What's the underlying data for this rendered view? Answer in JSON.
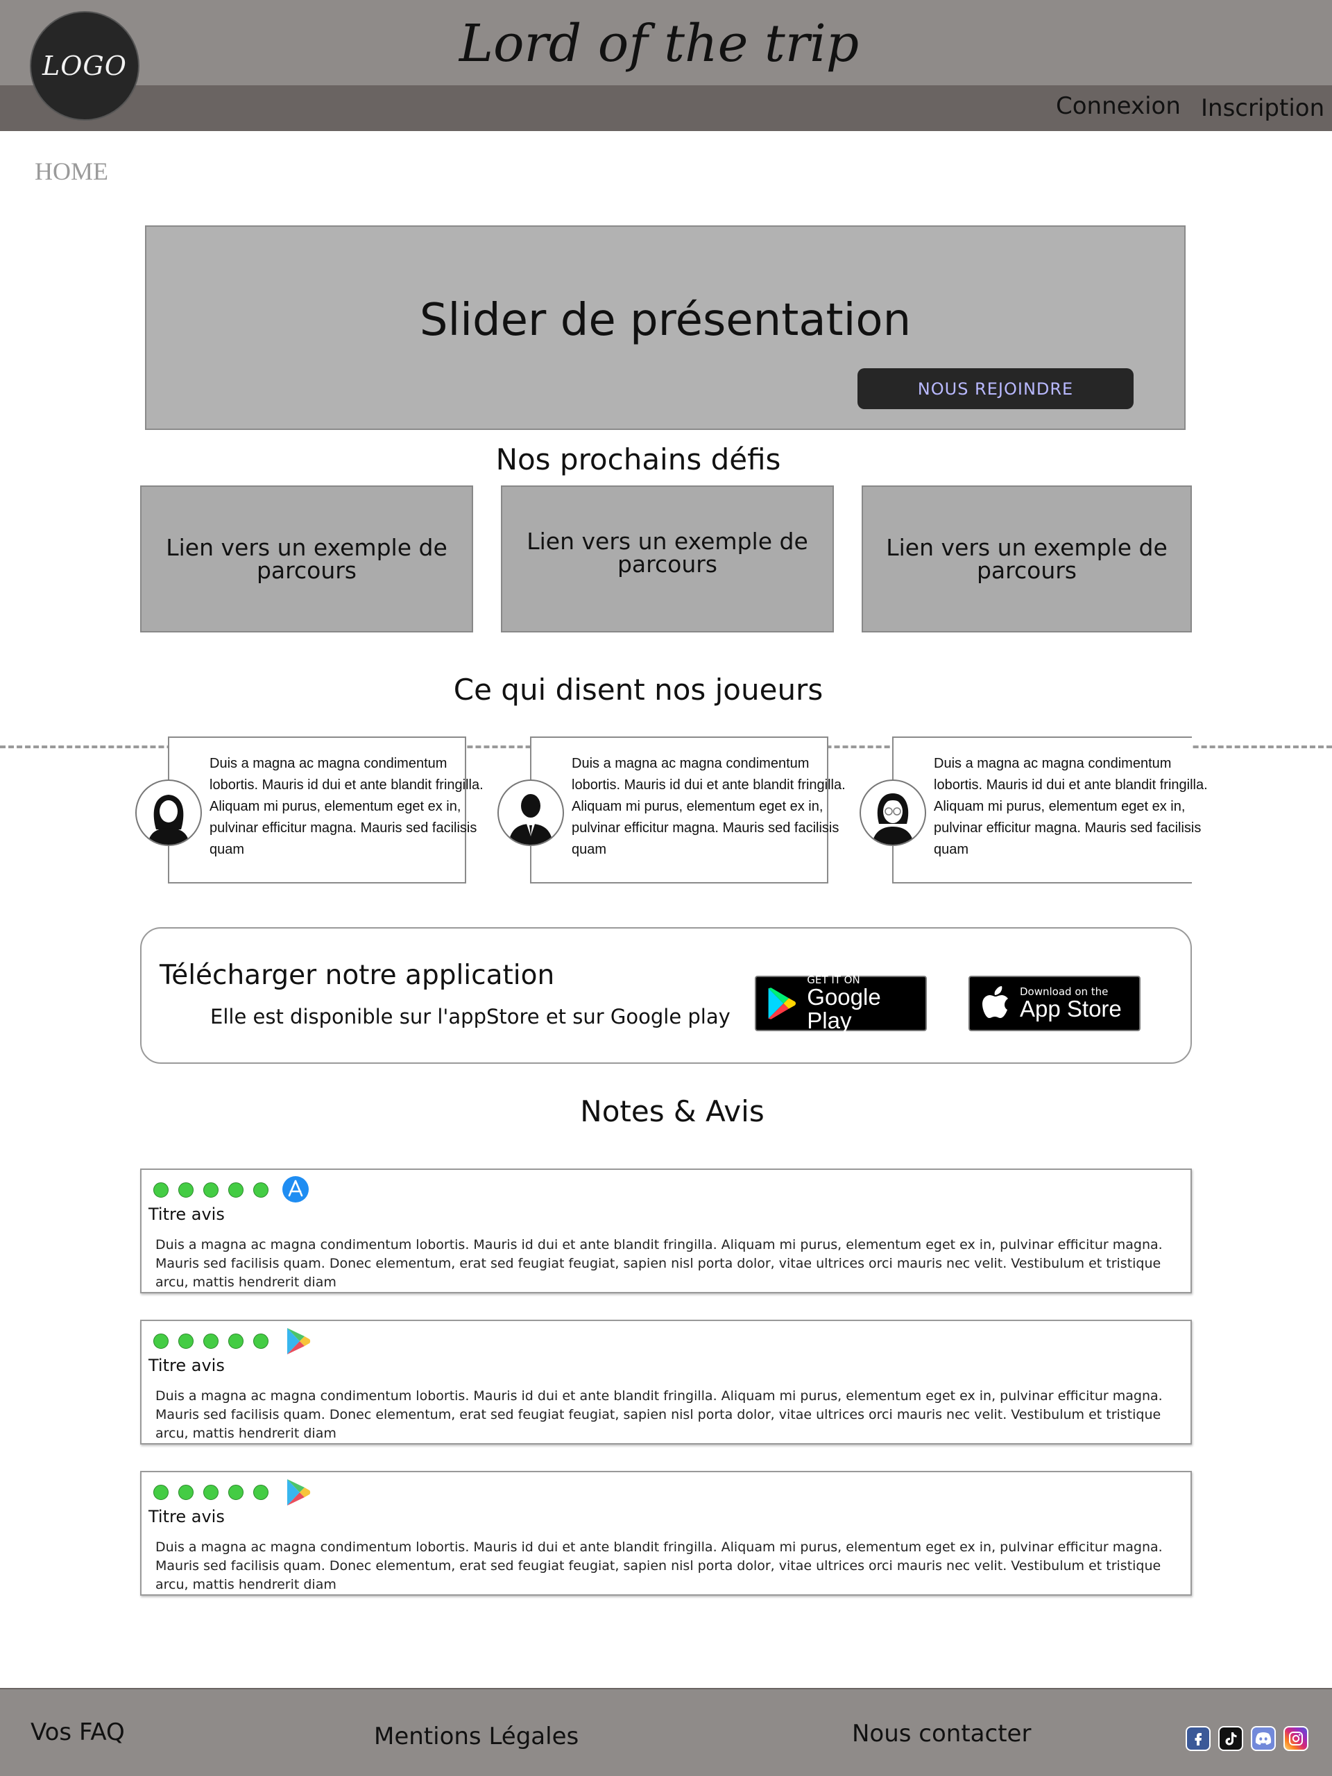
{
  "header": {
    "logo_text": "LOGO",
    "site_title": "Lord of the trip",
    "nav": {
      "login": "Connexion",
      "signup": "Inscription"
    }
  },
  "breadcrumb": "HOME",
  "slider": {
    "title": "Slider de présentation",
    "button": "NOUS REJOINDRE"
  },
  "challenges": {
    "title": "Nos prochains défis",
    "items": [
      "Lien vers un exemple de parcours",
      "Lien vers un exemple de parcours",
      "Lien vers un exemple de parcours"
    ]
  },
  "testimonials": {
    "title": "Ce qui disent nos joueurs",
    "items": [
      {
        "avatar": "woman-avatar-icon",
        "text": "Duis a magna ac magna condimentum lobortis. Mauris id dui et ante blandit fringilla. Aliquam mi purus, elementum eget ex in, pulvinar efficitur magna. Mauris sed facilisis quam"
      },
      {
        "avatar": "man-avatar-icon",
        "text": "Duis a magna ac magna condimentum lobortis. Mauris id dui et ante blandit fringilla. Aliquam mi purus, elementum eget ex in, pulvinar efficitur magna. Mauris sed facilisis quam"
      },
      {
        "avatar": "woman-glasses-avatar-icon",
        "text": "Duis a magna ac magna condimentum lobortis. Mauris id dui et ante blandit fringilla. Aliquam mi purus, elementum eget ex in, pulvinar efficitur magna. Mauris sed facilisis quam"
      }
    ]
  },
  "app": {
    "title": "Télécharger notre application",
    "subtitle": "Elle est disponible sur l'appStore et sur Google play",
    "google_small": "GET IT ON",
    "google_big": "Google Play",
    "apple_small": "Download on the",
    "apple_big": "App Store"
  },
  "reviews": {
    "title": "Notes & Avis",
    "items": [
      {
        "rating": 5,
        "source_icon": "app-store-icon",
        "title": "Titre avis",
        "body": "Duis a magna ac magna condimentum lobortis. Mauris id dui et ante blandit fringilla. Aliquam mi purus, elementum eget ex in, pulvinar efficitur magna. Mauris sed facilisis quam. Donec elementum, erat sed feugiat feugiat, sapien nisl porta dolor, vitae ultrices orci mauris nec velit. Vestibulum et tristique arcu, mattis hendrerit diam"
      },
      {
        "rating": 5,
        "source_icon": "google-play-icon",
        "title": "Titre avis",
        "body": "Duis a magna ac magna condimentum lobortis. Mauris id dui et ante blandit fringilla. Aliquam mi purus, elementum eget ex in, pulvinar efficitur magna. Mauris sed facilisis quam. Donec elementum, erat sed feugiat feugiat, sapien nisl porta dolor, vitae ultrices orci mauris nec velit. Vestibulum et tristique arcu, mattis hendrerit diam"
      },
      {
        "rating": 5,
        "source_icon": "google-play-icon",
        "title": "Titre avis",
        "body": "Duis a magna ac magna condimentum lobortis. Mauris id dui et ante blandit fringilla. Aliquam mi purus, elementum eget ex in, pulvinar efficitur magna. Mauris sed facilisis quam. Donec elementum, erat sed feugiat feugiat, sapien nisl porta dolor, vitae ultrices orci mauris nec velit. Vestibulum et tristique arcu, mattis hendrerit diam"
      }
    ]
  },
  "footer": {
    "faq": "Vos FAQ",
    "legal": "Mentions Légales",
    "contact": "Nous contacter",
    "socials": [
      "facebook-icon",
      "tiktok-icon",
      "discord-icon",
      "instagram-icon"
    ]
  },
  "colors": {
    "header_top": "#8f8b89",
    "header_bottom": "#6a6462",
    "slider_bg": "#b2b2b2",
    "card_bg": "#ababab",
    "button_bg": "#262626",
    "button_text": "#b9b9ff",
    "rating_dot": "#44cc44"
  }
}
